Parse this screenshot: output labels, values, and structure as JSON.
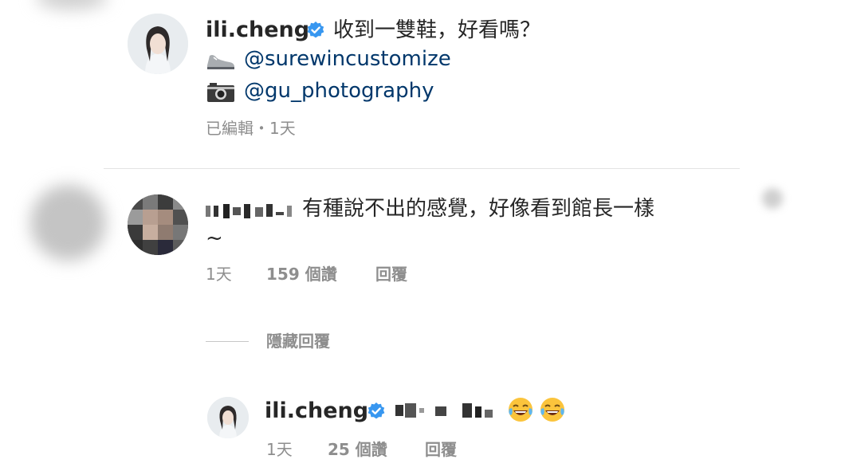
{
  "post": {
    "username": "ili.cheng",
    "caption": "收到一雙鞋，好看嗎？",
    "mention_1": "@surewincustomize",
    "mention_2": "@gu_photography",
    "meta": "已編輯・1天"
  },
  "comment": {
    "text_line1": "有種說不出的感覺，好像看到館長一樣",
    "text_line2": "~",
    "time": "1天",
    "likes": "159 個讚",
    "reply": "回覆",
    "hide_replies": "隱藏回覆"
  },
  "reply": {
    "username": "ili.cheng",
    "time": "1天",
    "likes": "25 個讚",
    "reply": "回覆"
  }
}
